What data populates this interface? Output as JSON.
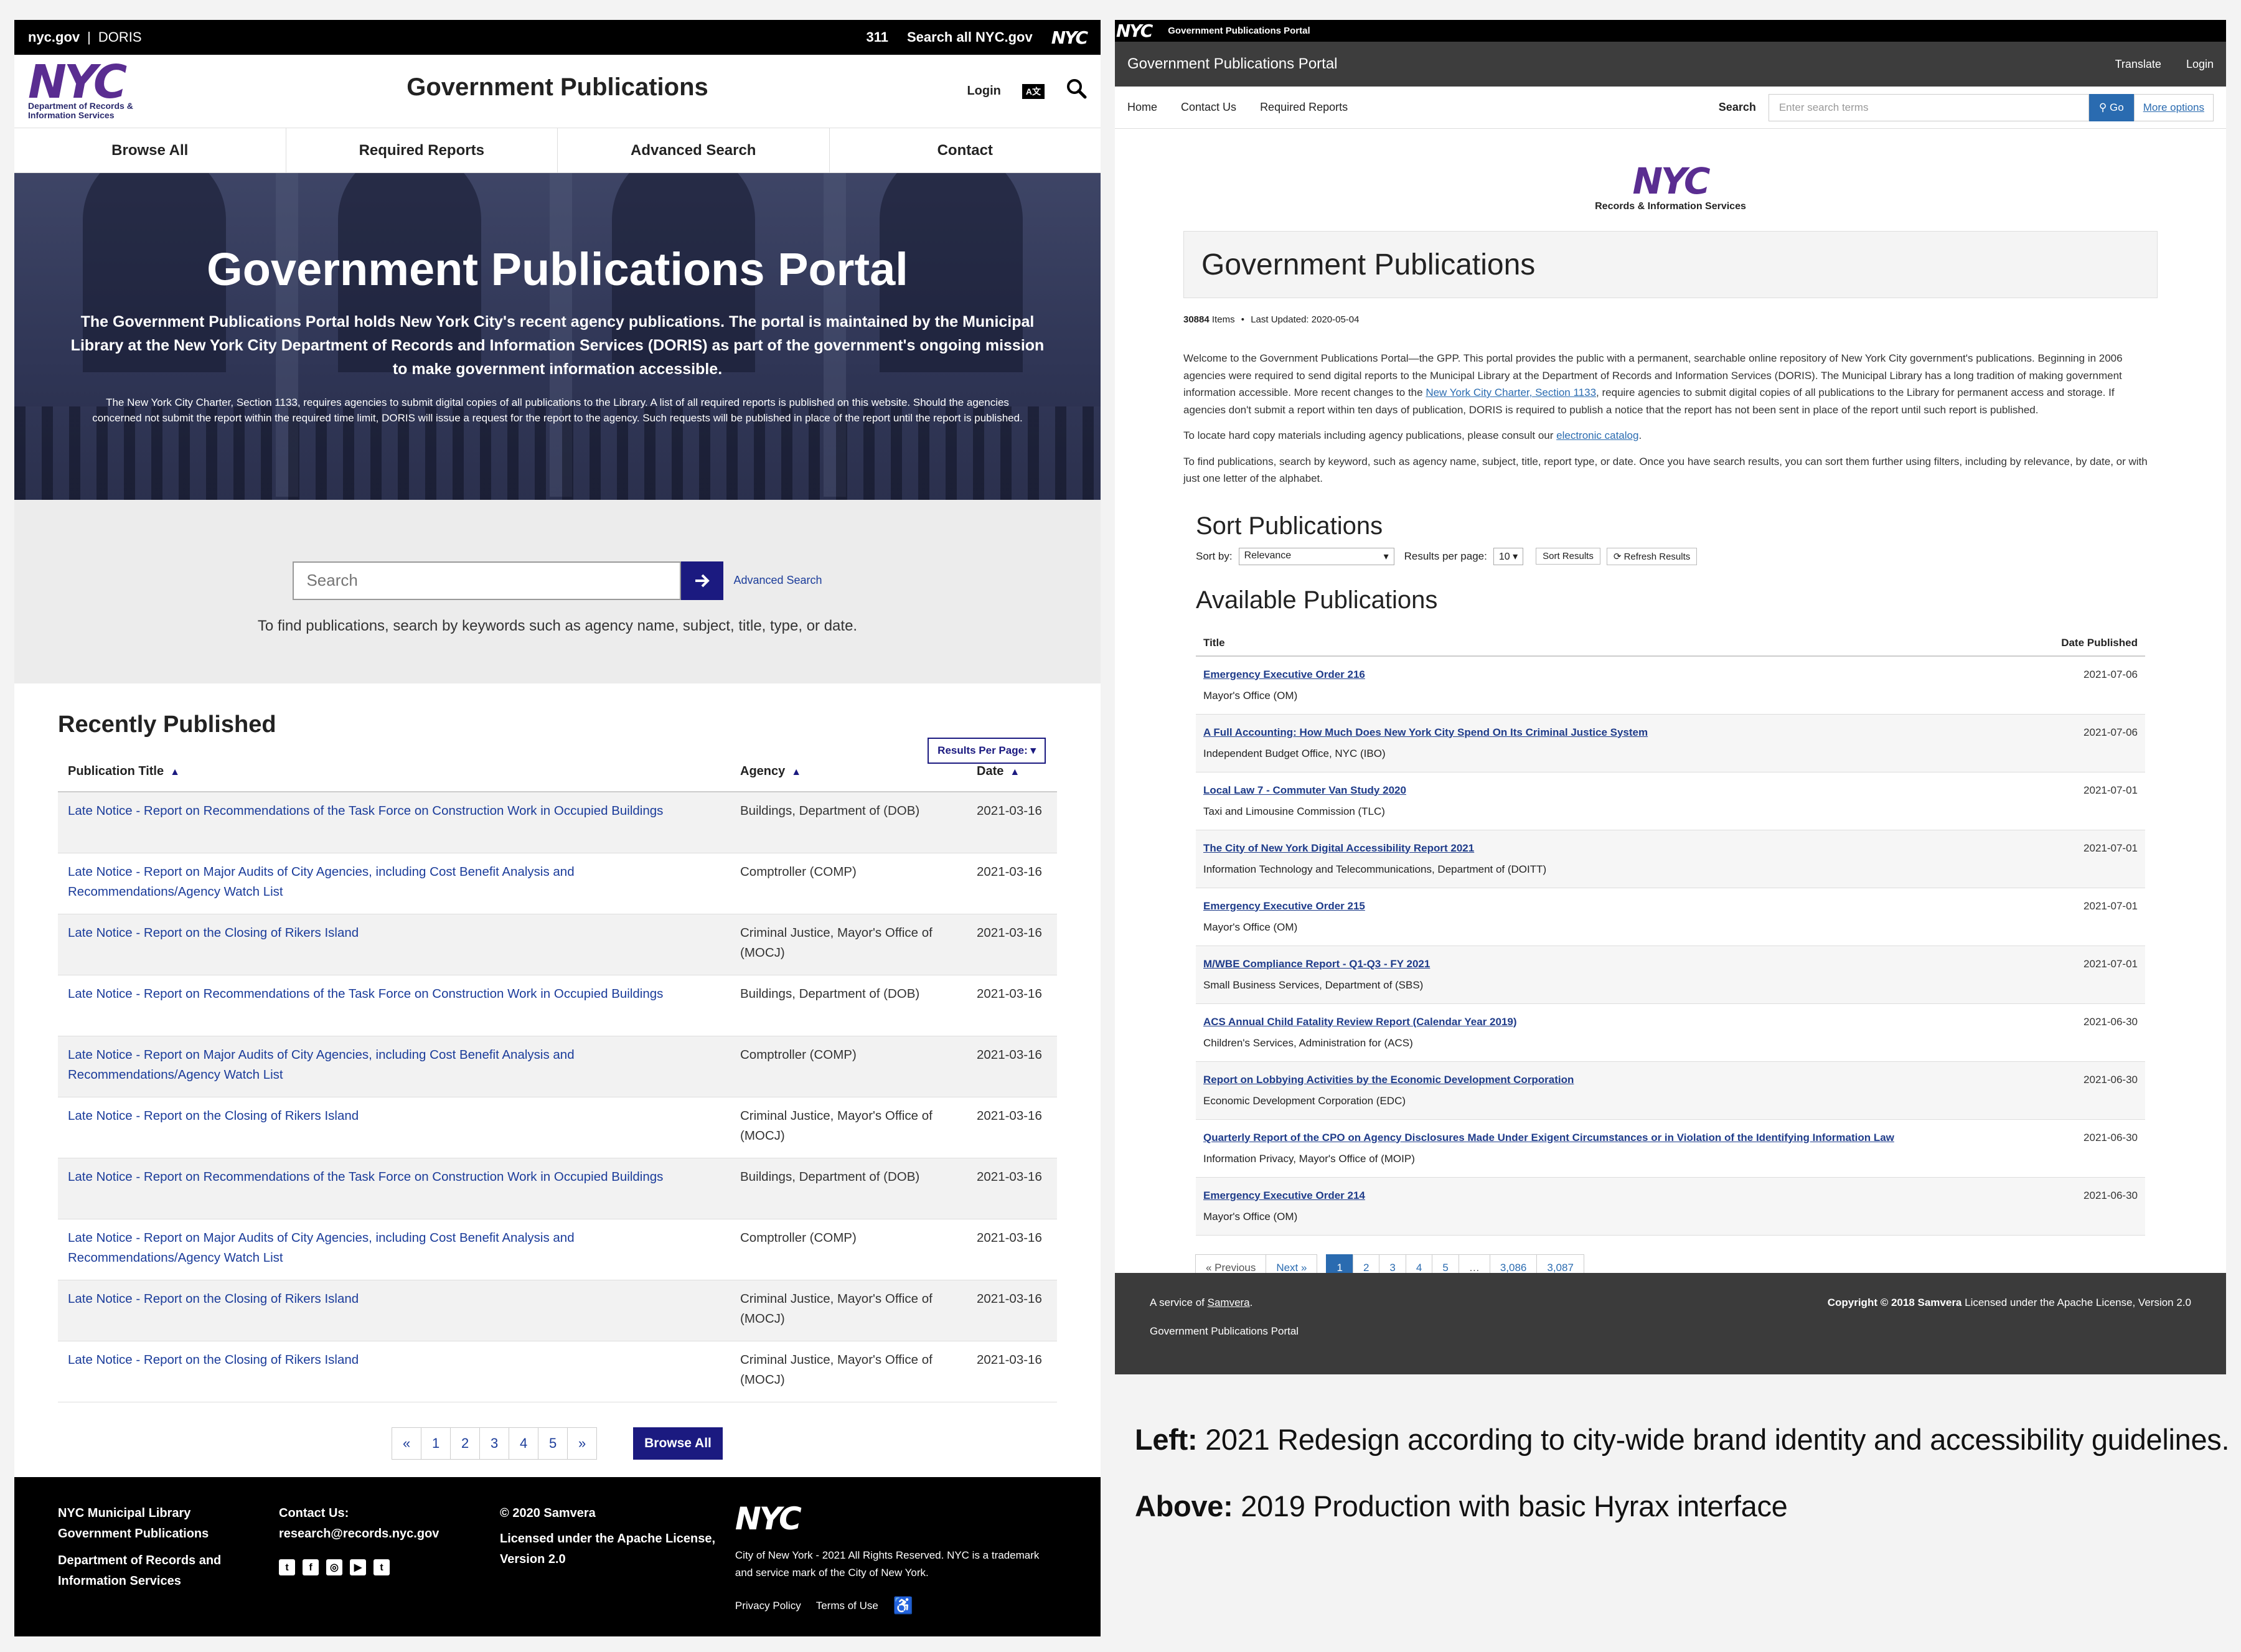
{
  "left": {
    "topbar": {
      "brand": "nyc.gov",
      "divider": "|",
      "org": "DORIS",
      "link311": "311",
      "search_all": "Search all NYC.gov",
      "nyc_logo": "NYC"
    },
    "header": {
      "logo_text": "NYC",
      "logo_dept": "Department of Records & Information Services",
      "title": "Government Publications",
      "login": "Login",
      "translate_icon": "A文",
      "search_icon": "⚲"
    },
    "nav": [
      "Browse All",
      "Required Reports",
      "Advanced Search",
      "Contact"
    ],
    "hero": {
      "title": "Government Publications Portal",
      "lead": "The Government Publications Portal holds New York City's recent agency publications. The portal is maintained by the Municipal Library at the New York City Department of Records and Information Services (DORIS) as part of the government's ongoing mission to make government information accessible.",
      "note": "The New York City Charter, Section 1133, requires agencies to submit digital copies of all publications to the Library. A list of all required reports is published on this website. Should the agencies concerned not submit the report within the required time limit, DORIS will issue a request for the report to the agency. Such requests will be published in place of the report until the report is published."
    },
    "search": {
      "placeholder": "Search",
      "advanced": "Advanced Search",
      "help": "To find publications, search by keywords such as agency name, subject, title, type, or date."
    },
    "recent": {
      "heading": "Recently Published",
      "results_per_page": "Results Per Page: ▾",
      "columns": [
        "Publication Title",
        "Agency",
        "Date"
      ],
      "rows": [
        {
          "title": "Late Notice - Report on Recommendations of the Task Force on Construction Work in Occupied Buildings",
          "agency": "Buildings, Department of (DOB)",
          "date": "2021-03-16"
        },
        {
          "title": "Late Notice - Report on Major Audits of City Agencies, including Cost Benefit Analysis and Recommendations/Agency Watch List",
          "agency": "Comptroller (COMP)",
          "date": "2021-03-16"
        },
        {
          "title": "Late Notice - Report on the Closing of Rikers Island",
          "agency": "Criminal Justice, Mayor's Office of (MOCJ)",
          "date": "2021-03-16"
        },
        {
          "title": "Late Notice - Report on Recommendations of the Task Force on Construction Work in Occupied Buildings",
          "agency": "Buildings, Department of (DOB)",
          "date": "2021-03-16"
        },
        {
          "title": "Late Notice - Report on Major Audits of City Agencies, including Cost Benefit Analysis and Recommendations/Agency Watch List",
          "agency": "Comptroller (COMP)",
          "date": "2021-03-16"
        },
        {
          "title": "Late Notice - Report on the Closing of Rikers Island",
          "agency": "Criminal Justice, Mayor's Office of (MOCJ)",
          "date": "2021-03-16"
        },
        {
          "title": "Late Notice - Report on Recommendations of the Task Force on Construction Work in Occupied Buildings",
          "agency": "Buildings, Department of (DOB)",
          "date": "2021-03-16"
        },
        {
          "title": "Late Notice - Report on Major Audits of City Agencies, including Cost Benefit Analysis and Recommendations/Agency Watch List",
          "agency": "Comptroller (COMP)",
          "date": "2021-03-16"
        },
        {
          "title": "Late Notice - Report on the Closing of Rikers Island",
          "agency": "Criminal Justice, Mayor's Office of (MOCJ)",
          "date": "2021-03-16"
        },
        {
          "title": "Late Notice - Report on the Closing of Rikers Island",
          "agency": "Criminal Justice, Mayor's Office of (MOCJ)",
          "date": "2021-03-16"
        }
      ]
    },
    "pagination": {
      "prev": "«",
      "pages": [
        "1",
        "2",
        "3",
        "4",
        "5"
      ],
      "next": "»",
      "browse_all": "Browse All"
    },
    "footer": {
      "col1": [
        "NYC Municipal Library",
        "Government Publications",
        "Department of Records and",
        "Information Services"
      ],
      "col2_title": "Contact Us:",
      "col2_email": "research@records.nyc.gov",
      "col3_copy": "© 2020 Samvera",
      "col3_license": "Licensed under the Apache License, Version 2.0",
      "col4_logo": "NYC",
      "col4_text": "City of New York - 2021 All Rights Reserved. NYC is a trademark and service mark of the City of New York.",
      "privacy": "Privacy Policy",
      "terms": "Terms of Use",
      "accessibility_icon": "♿"
    }
  },
  "right": {
    "top1": {
      "logo": "NYC",
      "title": "Government Publications Portal"
    },
    "top2": {
      "title": "Government Publications Portal",
      "translate": "Translate",
      "login": "Login"
    },
    "nav": {
      "home": "Home",
      "contact": "Contact Us",
      "required": "Required Reports",
      "search_label": "Search",
      "search_placeholder": "Enter search terms",
      "go": "Go",
      "more": "More options"
    },
    "logo": {
      "nyc": "NYC",
      "ris": "Records & Information Services"
    },
    "title": "Government Publications",
    "meta": {
      "count": "30884",
      "items": "Items",
      "sep": "•",
      "updated": "Last Updated: 2020-05-04"
    },
    "intro": {
      "p1a": "Welcome to the Government Publications Portal—the GPP. This portal provides the public with a permanent, searchable online repository of New York City government's publications. Beginning in 2006 agencies were required to send digital reports to the Municipal Library at the Department of Records and Information Services (DORIS). The Municipal Library has a long tradition of making government information accessible. More recent changes to the ",
      "p1link": "New York City Charter, Section 1133",
      "p1b": ", require agencies to submit digital copies of all publications to the Library for permanent access and storage. If agencies don't submit a report within ten days of publication, DORIS is required to publish a notice that the report has not been sent in place of the report until such report is published.",
      "p2a": "To locate hard copy materials including agency publications, please consult our ",
      "p2link": "electronic catalog",
      "p2b": ".",
      "p3": "To find publications, search by keyword, such as agency name, subject, title, report type, or date. Once you have search results, you can sort them further using filters, including by relevance, by date, or with just one letter of the alphabet."
    },
    "sort": {
      "heading": "Sort Publications",
      "sort_by": "Sort by:",
      "relevance": "Relevance",
      "rpp": "Results per page:",
      "rpp_val": "10",
      "sort_btn": "Sort Results",
      "refresh_btn": "⟳ Refresh Results"
    },
    "available": {
      "heading": "Available Publications",
      "columns": [
        "Title",
        "Date Published"
      ],
      "rows": [
        {
          "title": "Emergency Executive Order 216",
          "agency": "Mayor's Office (OM)",
          "date": "2021-07-06"
        },
        {
          "title": "A Full Accounting: How Much Does New York City Spend On Its Criminal Justice System",
          "agency": "Independent Budget Office, NYC (IBO)",
          "date": "2021-07-06"
        },
        {
          "title": "Local Law 7 - Commuter Van Study 2020",
          "agency": "Taxi and Limousine Commission (TLC)",
          "date": "2021-07-01"
        },
        {
          "title": "The City of New York Digital Accessibility Report 2021",
          "agency": "Information Technology and Telecommunications, Department of (DOITT)",
          "date": "2021-07-01"
        },
        {
          "title": "Emergency Executive Order 215",
          "agency": "Mayor's Office (OM)",
          "date": "2021-07-01"
        },
        {
          "title": "M/WBE Compliance Report - Q1-Q3 - FY 2021",
          "agency": "Small Business Services, Department of (SBS)",
          "date": "2021-07-01"
        },
        {
          "title": "ACS Annual Child Fatality Review Report (Calendar Year 2019)",
          "agency": "Children's Services, Administration for (ACS)",
          "date": "2021-06-30"
        },
        {
          "title": "Report on Lobbying Activities by the Economic Development Corporation",
          "agency": "Economic Development Corporation (EDC)",
          "date": "2021-06-30"
        },
        {
          "title": "Quarterly Report of the CPO on Agency Disclosures Made Under Exigent Circumstances or in Violation of the Identifying Information Law",
          "agency": "Information Privacy, Mayor's Office of (MOIP)",
          "date": "2021-06-30"
        },
        {
          "title": "Emergency Executive Order 214",
          "agency": "Mayor's Office (OM)",
          "date": "2021-06-30"
        }
      ]
    },
    "pagination": {
      "prev": "« Previous",
      "next": "Next »",
      "pages": [
        "1",
        "2",
        "3",
        "4",
        "5",
        "…",
        "3,086",
        "3,087"
      ]
    },
    "footer": {
      "service_prefix": "A service of ",
      "service_link": "Samvera",
      "service_suffix": ".",
      "portal": "Government Publications Portal",
      "copyright": "Copyright © 2018 Samvera",
      "license": " Licensed under the Apache License, Version 2.0"
    }
  },
  "captions": {
    "left_label": "Left:",
    "left_text": " 2021 Redesign according to city-wide brand identity and accessibility guidelines.",
    "above_label": "Above:",
    "above_text": " 2019 Production with basic Hyrax interface"
  },
  "colors": {
    "accent_navy": "#1b1a80",
    "nyc_purple": "#5a2d91",
    "link_blue": "#1b3c9a",
    "hyrax_blue": "#2a6bb0",
    "hyrax_dark": "#3d3d3d"
  }
}
